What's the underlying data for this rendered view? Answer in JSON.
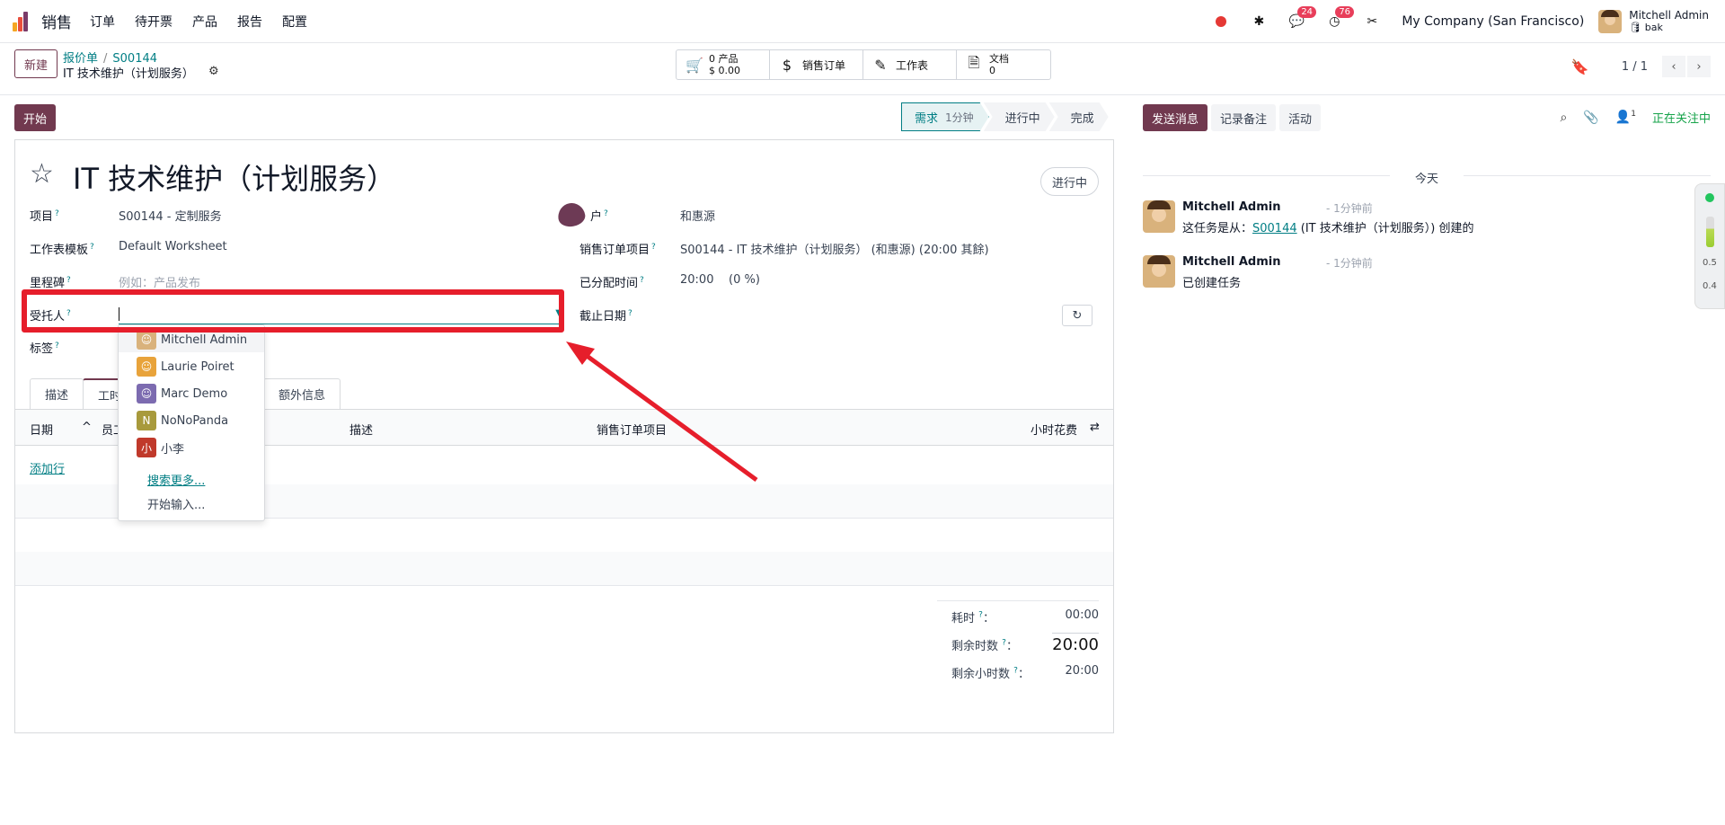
{
  "app": {
    "name": "销售",
    "menu": [
      "订单",
      "待开票",
      "产品",
      "报告",
      "配置"
    ]
  },
  "topbar": {
    "chat_count": "24",
    "activity_count": "76",
    "company": "My Company (San Francisco)",
    "user_name": "Mitchell Admin",
    "user_db": "bak"
  },
  "control": {
    "new_label": "新建",
    "breadcrumb": [
      "报价单",
      "S00144"
    ],
    "record_title": "IT 技术维护（计划服务）",
    "smart_buttons": [
      {
        "line1": "0 产品",
        "line2": "$ 0.00",
        "icon": "cart-icon"
      },
      {
        "line1": "销售订单",
        "line2": "",
        "icon": "dollar-icon"
      },
      {
        "line1": "工作表",
        "line2": "",
        "icon": "pencil-icon"
      },
      {
        "line1": "文档",
        "line2": "0",
        "icon": "file-icon"
      }
    ],
    "pager": "1 / 1"
  },
  "status": {
    "start_label": "开始",
    "stages": [
      {
        "name": "需求",
        "sub": "1分钟"
      },
      {
        "name": "进行中"
      },
      {
        "name": "完成"
      }
    ]
  },
  "form": {
    "title": "IT 技术维护（计划服务）",
    "state": "进行中",
    "fields": {
      "project_label": "项目",
      "project_value": "S00144 - 定制服务",
      "worksheet_label": "工作表模板",
      "worksheet_value": "Default Worksheet",
      "milestone_label": "里程碑",
      "milestone_placeholder": "例如：产品发布",
      "assignee_label": "受托人",
      "tags_label": "标签",
      "customer_label": "户",
      "customer_value": "和惠源",
      "sol_label": "销售订单项目",
      "sol_value": "S00144 - IT 技术维护（计划服务） (和惠源) (20:00 其餘)",
      "alloc_label": "已分配时间",
      "alloc_value": "20:00",
      "alloc_pct": "(0 %)",
      "deadline_label": "截止日期"
    },
    "tabs": [
      "描述",
      "工时",
      "额外信息"
    ],
    "table": {
      "columns": [
        "日期",
        "员工",
        "描述",
        "销售订单项目",
        "小时花费"
      ],
      "add_line": "添加行"
    },
    "totals": [
      {
        "label": "耗时",
        "value": "00:00"
      },
      {
        "label": "剩余时数",
        "value": "20:00"
      },
      {
        "label": "剩余小时数",
        "value": "20:00"
      }
    ]
  },
  "dropdown": {
    "options": [
      {
        "name": "Mitchell Admin",
        "initial": "",
        "color": "#d9b27c"
      },
      {
        "name": "Laurie Poiret",
        "initial": "",
        "color": "#e8a33b"
      },
      {
        "name": "Marc Demo",
        "initial": "",
        "color": "#7c6bb0"
      },
      {
        "name": "NoNoPanda",
        "initial": "N",
        "color": "#a89a3c"
      },
      {
        "name": "小李",
        "initial": "小",
        "color": "#c0392b"
      }
    ],
    "search_more": "搜索更多...",
    "start_typing": "开始输入..."
  },
  "chatter": {
    "send_message": "发送消息",
    "log_note": "记录备注",
    "activity": "活动",
    "followers": "1",
    "following": "正在关注中",
    "date_sep": "今天",
    "messages": [
      {
        "author": "Mitchell Admin",
        "time": "- 1分钟前",
        "body_prefix": "这任务是从：",
        "link": "S00144",
        "body_suffix": " (IT 技术维护（计划服务）) 创建的"
      },
      {
        "author": "Mitchell Admin",
        "time": "- 1分钟前",
        "body": "已创建任务"
      }
    ]
  },
  "side_widget": {
    "up": "0.5",
    "down": "0.4"
  },
  "colors": {
    "brand": "#71394f",
    "link": "#017e84",
    "highlight": "#e61e2b"
  }
}
